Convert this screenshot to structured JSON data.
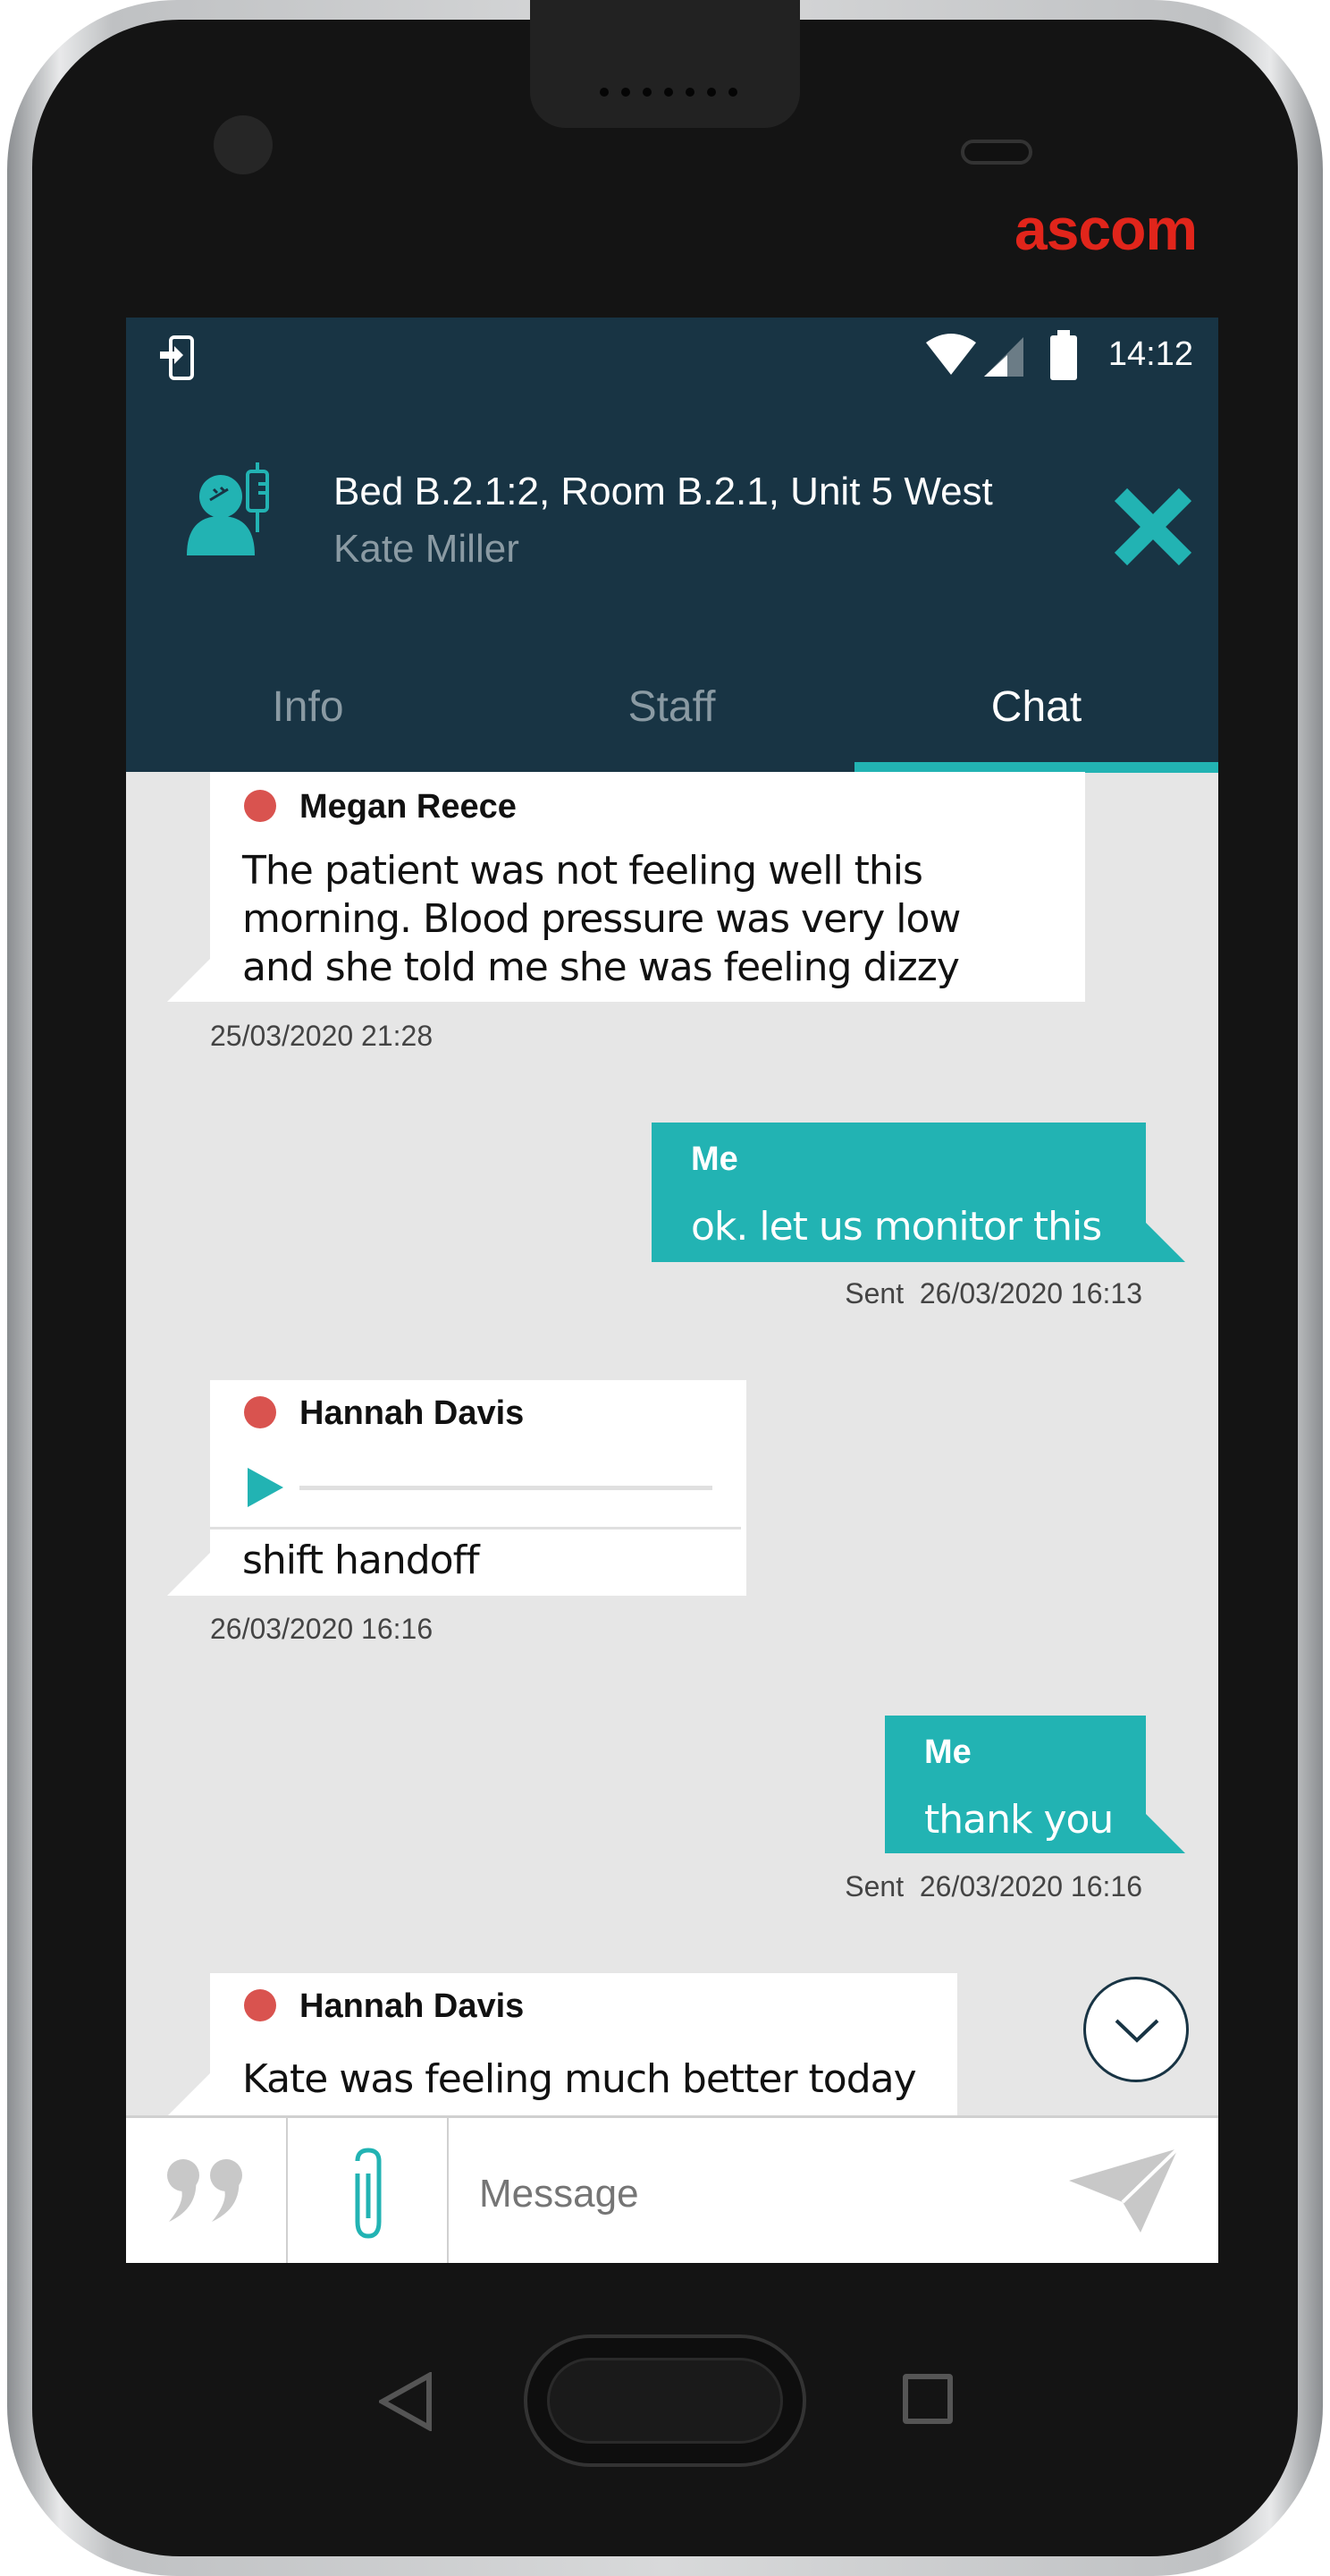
{
  "device": {
    "brand": "ascom"
  },
  "status_bar": {
    "time": "14:12",
    "icons": [
      "sim-login-icon",
      "wifi-icon",
      "signal-icon",
      "battery-icon"
    ]
  },
  "header": {
    "title": "Bed B.2.1:2, Room B.2.1, Unit 5 West",
    "subtitle": "Kate Miller",
    "icon": "patient-iv-icon",
    "close_icon": "close-icon"
  },
  "tabs": [
    {
      "label": "Info"
    },
    {
      "label": "Staff"
    },
    {
      "label": "Chat",
      "active": true
    }
  ],
  "messages": [
    {
      "sender": "Megan Reece",
      "lines": [
        "The patient was not feeling well this",
        "morning. Blood pressure was very low",
        "and she told me she was feeling dizzy"
      ],
      "timestamp": "25/03/2020 21:28"
    },
    {
      "sender": "Me",
      "text": "ok. let us monitor this",
      "status": "Sent",
      "timestamp": "26/03/2020 16:13"
    },
    {
      "sender": "Hannah Davis",
      "text": "shift handoff",
      "attachment": "audio",
      "timestamp": "26/03/2020 16:16"
    },
    {
      "sender": "Me",
      "text": "thank you",
      "status": "Sent",
      "timestamp": "26/03/2020 16:16"
    },
    {
      "sender": "Hannah Davis",
      "text": "Kate was feeling much better today"
    }
  ],
  "input": {
    "placeholder": "Message"
  },
  "colors": {
    "header": "#183444",
    "accent": "#22b3b3",
    "presence": "#d9534f",
    "chat_bg": "#e6e6e6",
    "brand": "#e1251b"
  }
}
